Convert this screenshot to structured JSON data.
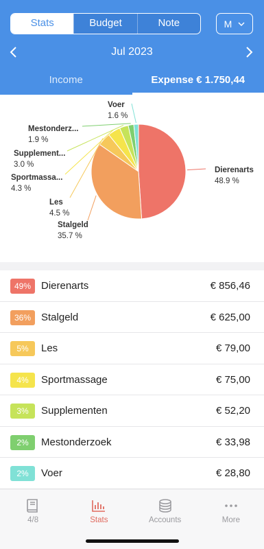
{
  "header": {
    "segments": [
      "Stats",
      "Budget",
      "Note"
    ],
    "active_segment": "Stats",
    "period_button": "M",
    "month": "Jul 2023",
    "tabs": {
      "income": "Income",
      "expense": "Expense € 1.750,44"
    },
    "active_tab": "expense"
  },
  "chart_data": {
    "type": "pie",
    "slices": [
      {
        "label": "Dierenarts",
        "percent": 48.9,
        "percent_label": "48.9 %",
        "color": "#ee7468"
      },
      {
        "label": "Stalgeld",
        "percent": 35.7,
        "percent_label": "35.7 %",
        "color": "#f29f5e"
      },
      {
        "label": "Les",
        "percent": 4.5,
        "percent_label": "4.5 %",
        "color": "#f6c85a"
      },
      {
        "label": "Sportmassa...",
        "percent": 4.3,
        "percent_label": "4.3 %",
        "color": "#f5e44c"
      },
      {
        "label": "Supplement...",
        "percent": 3.0,
        "percent_label": "3.0 %",
        "color": "#c6e35a"
      },
      {
        "label": "Mestonderz...",
        "percent": 1.9,
        "percent_label": "1.9 %",
        "color": "#7fcf6f"
      },
      {
        "label": "Voer",
        "percent": 1.6,
        "percent_label": "1.6 %",
        "color": "#80e1d6"
      }
    ]
  },
  "list": {
    "rows": [
      {
        "badge": "49%",
        "name": "Dierenarts",
        "amount": "€ 856,46",
        "color": "#ee7468"
      },
      {
        "badge": "36%",
        "name": "Stalgeld",
        "amount": "€ 625,00",
        "color": "#f29f5e"
      },
      {
        "badge": "5%",
        "name": "Les",
        "amount": "€ 79,00",
        "color": "#f6c85a"
      },
      {
        "badge": "4%",
        "name": "Sportmassage",
        "amount": "€ 75,00",
        "color": "#f5e44c"
      },
      {
        "badge": "3%",
        "name": "Supplementen",
        "amount": "€ 52,20",
        "color": "#c6e35a"
      },
      {
        "badge": "2%",
        "name": "Mestonderzoek",
        "amount": "€ 33,98",
        "color": "#7fcf6f"
      },
      {
        "badge": "2%",
        "name": "Voer",
        "amount": "€ 28,80",
        "color": "#80e1d6"
      }
    ]
  },
  "bottom_nav": {
    "items": [
      {
        "label": "4/8",
        "icon": "book-icon"
      },
      {
        "label": "Stats",
        "icon": "bar-chart-icon"
      },
      {
        "label": "Accounts",
        "icon": "coins-icon"
      },
      {
        "label": "More",
        "icon": "more-dots-icon"
      }
    ],
    "active": "Stats",
    "active_color": "#e06a5e",
    "inactive_color": "#9a9a9e"
  },
  "colors": {
    "header_bg": "#4a90e6",
    "list_bg": "#ffffff",
    "page_bg": "#f2f2f4"
  }
}
